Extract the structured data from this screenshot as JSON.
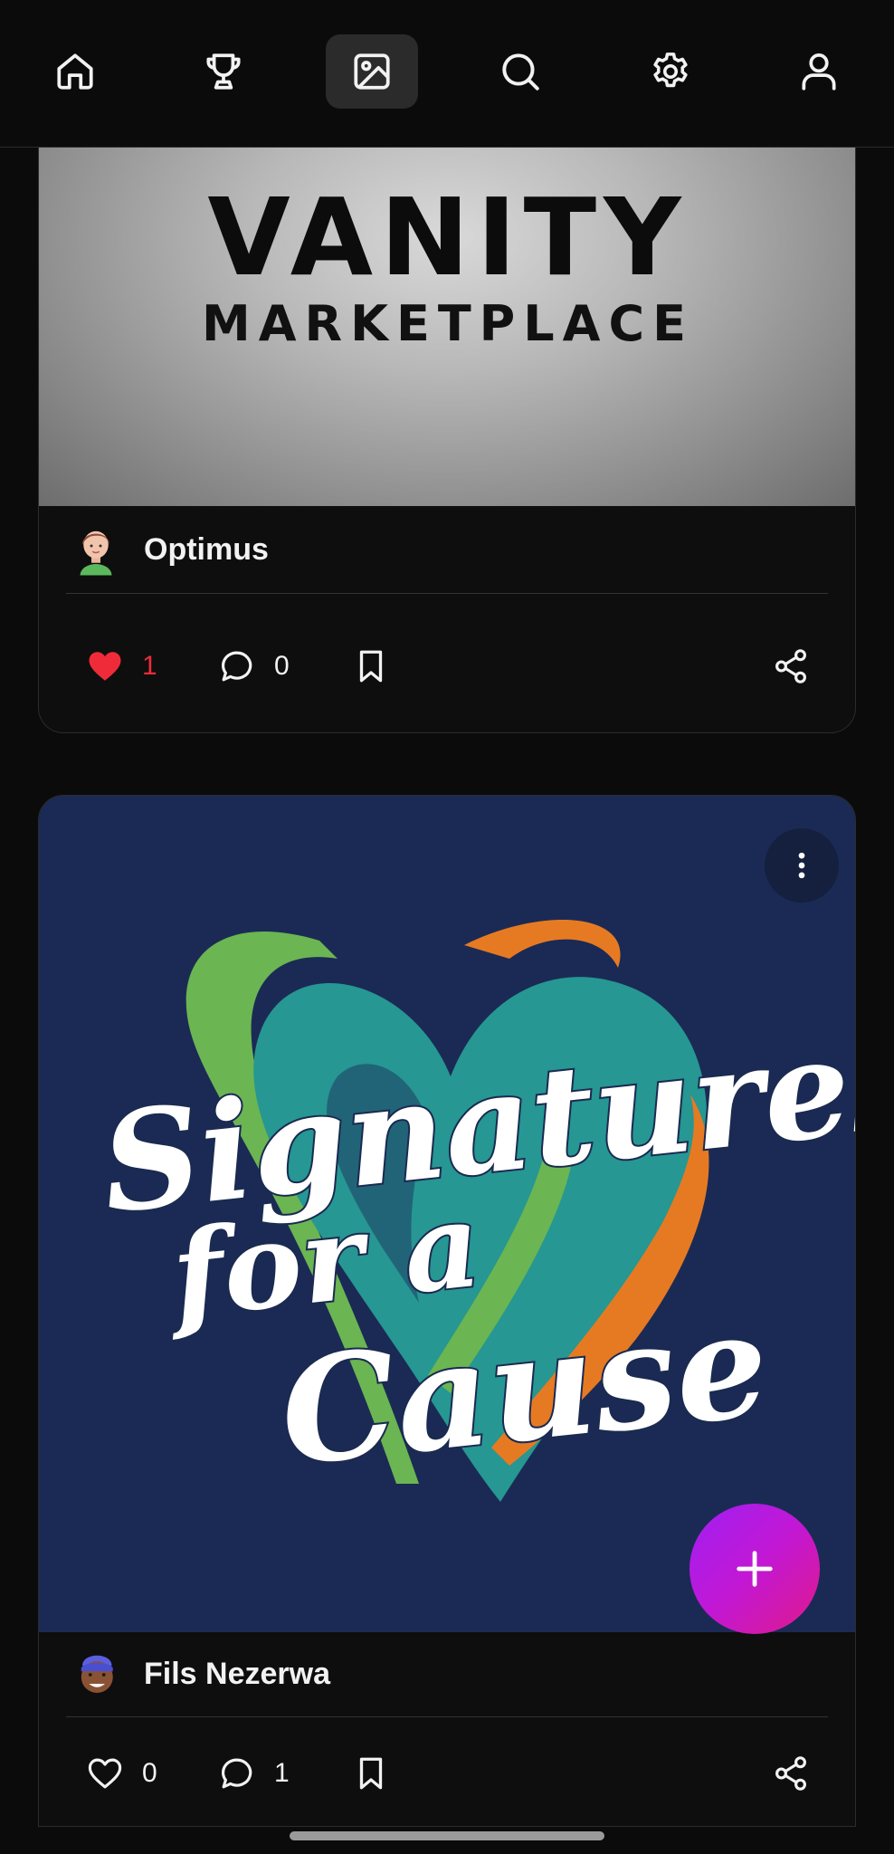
{
  "nav": {
    "items": [
      {
        "icon": "home-icon"
      },
      {
        "icon": "trophy-icon"
      },
      {
        "icon": "image-icon",
        "active": true
      },
      {
        "icon": "search-icon"
      },
      {
        "icon": "gear-icon"
      },
      {
        "icon": "user-icon"
      }
    ]
  },
  "posts": [
    {
      "image": {
        "title": "VANITY",
        "subtitle": "MARKETPLACE"
      },
      "author": "Optimus",
      "likes": "1",
      "liked": true,
      "comments": "0"
    },
    {
      "image": {
        "line1": "Signatures",
        "line2": "for a",
        "line3": "Cause"
      },
      "author": "Fils Nezerwa",
      "likes": "0",
      "liked": false,
      "comments": "1"
    }
  ],
  "colors": {
    "background": "#0b0b0b",
    "like_red": "#ef2b3a",
    "fab_gradient": [
      "#a01ff2",
      "#e01a8a"
    ],
    "card_navy": "#1b2a55"
  }
}
